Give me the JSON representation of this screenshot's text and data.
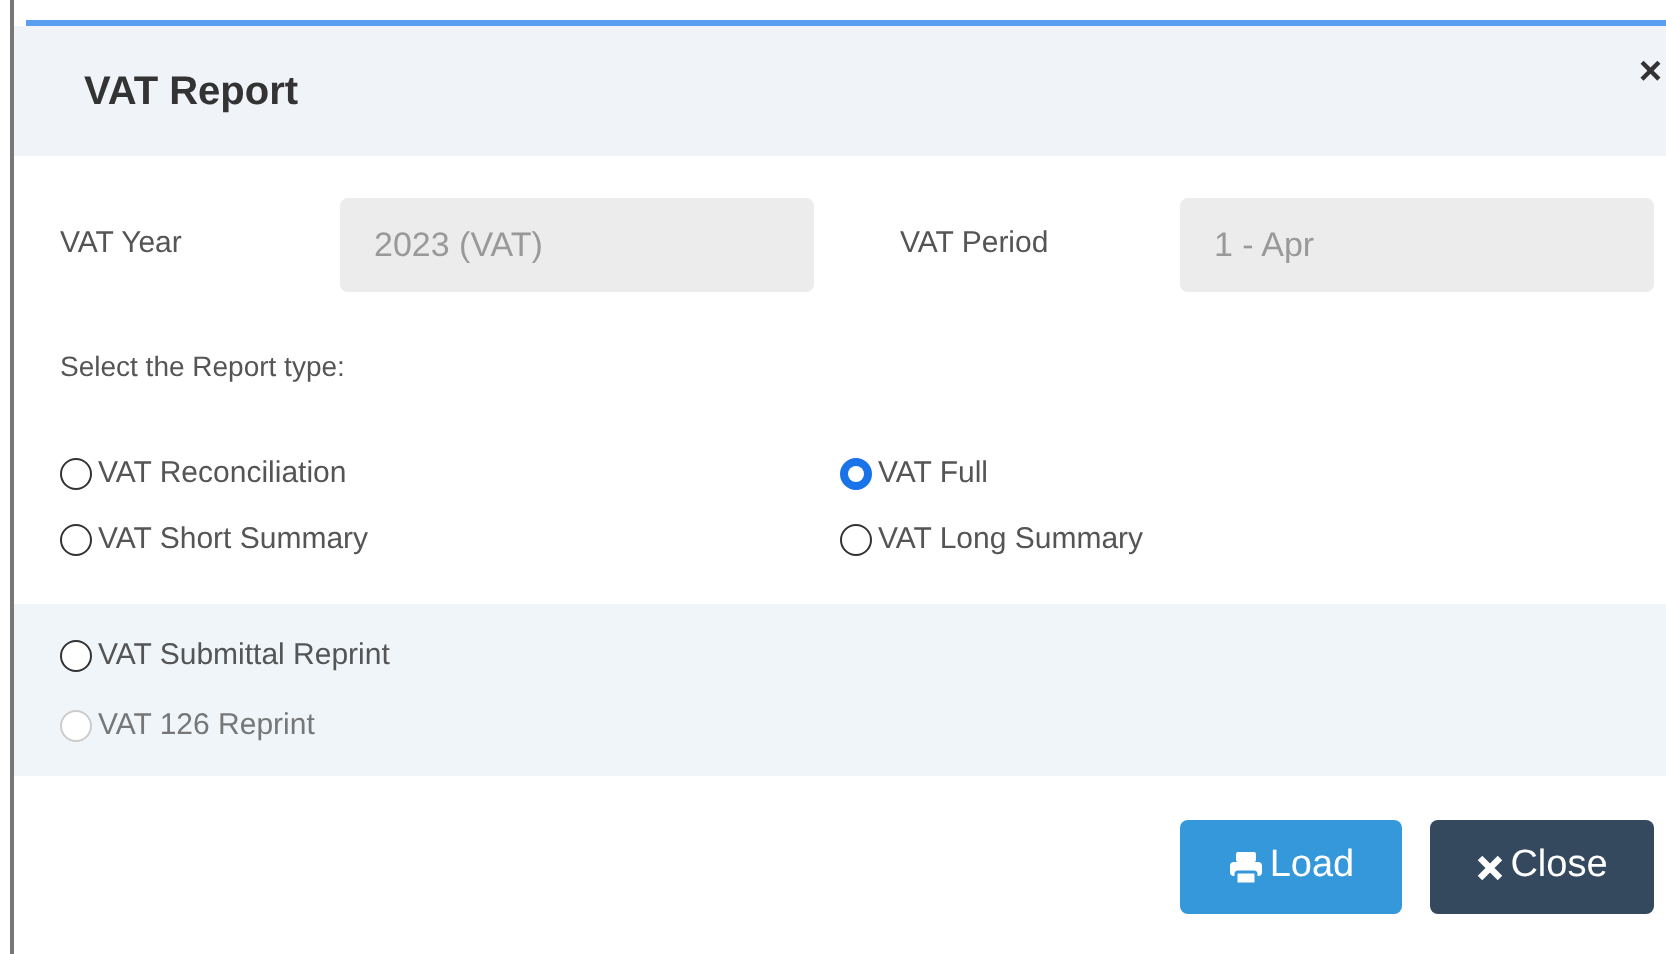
{
  "dialog": {
    "title": "VAT Report",
    "close_glyph": "×"
  },
  "fields": [
    {
      "label": "VAT Year",
      "value": "2023 (VAT)",
      "disabled": true
    },
    {
      "label": "VAT Period",
      "value": "1 - Apr",
      "disabled": true
    }
  ],
  "report_type_label": "Select the Report type:",
  "report_types": [
    {
      "label": "VAT Reconciliation",
      "selected": false,
      "disabled": false
    },
    {
      "label": "VAT Full",
      "selected": true,
      "disabled": false
    },
    {
      "label": "VAT Short Summary",
      "selected": false,
      "disabled": false
    },
    {
      "label": "VAT Long Summary",
      "selected": false,
      "disabled": false
    }
  ],
  "reprints": [
    {
      "label": "VAT Submittal Reprint",
      "selected": false,
      "disabled": false
    },
    {
      "label": "VAT 126 Reprint",
      "selected": false,
      "disabled": true
    }
  ],
  "buttons": [
    {
      "kind": "load",
      "label": "Load"
    },
    {
      "kind": "close",
      "label": "Close"
    }
  ]
}
